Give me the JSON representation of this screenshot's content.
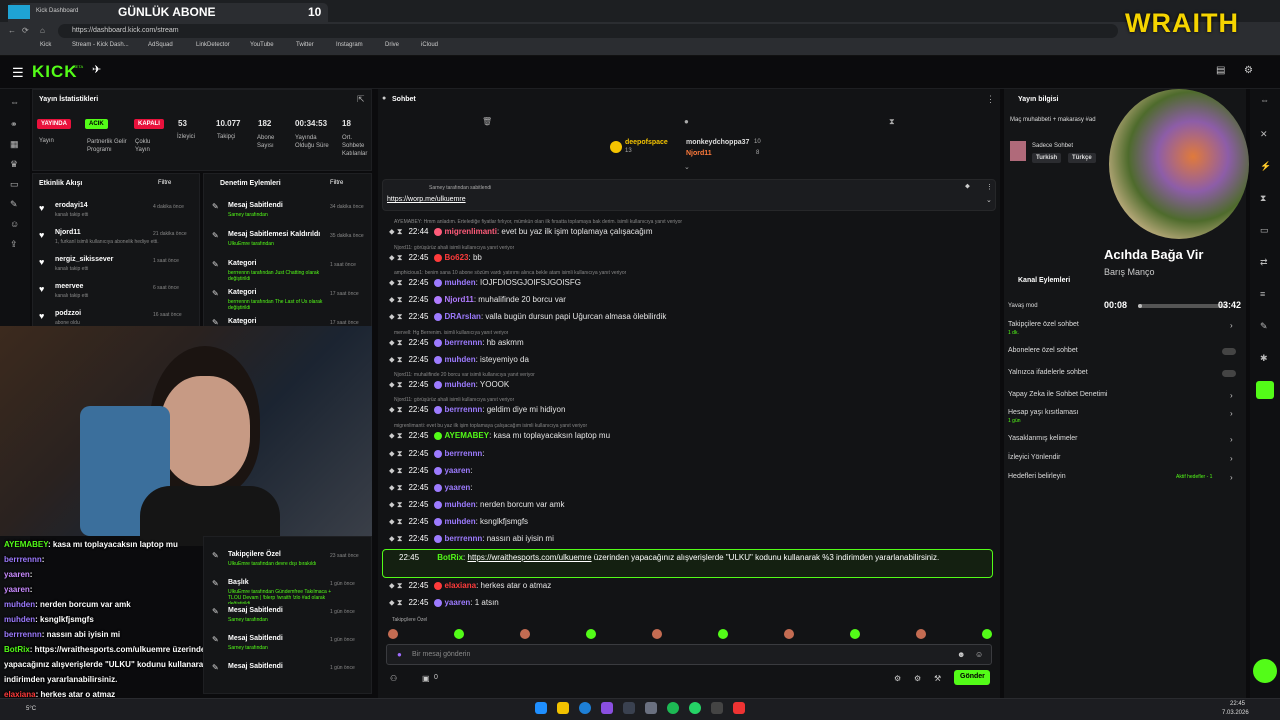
{
  "browser": {
    "tab_title": "Kick Dashboard",
    "overlay_title": "GÜNLÜK ABONE",
    "overlay_count": "10",
    "url": "https://dashboard.kick.com/stream",
    "bookmarks": [
      "Kick",
      "Stream - Kick Dash...",
      "AdSquad",
      "LinkDetector",
      "YouTube",
      "Twitter",
      "Instagram",
      "Drive",
      "iCloud"
    ]
  },
  "brand": {
    "logo": "KICK",
    "beta": "BETA",
    "wraith": "WRAITH",
    "accent": "#53fc18"
  },
  "stats": {
    "title": "Yayın İstatistikleri",
    "items": [
      {
        "badge": "YAYINDA",
        "label": "Yayın",
        "color": "#e9113c"
      },
      {
        "badge": "ACIK",
        "label": "Partnerlik Gelir Programı",
        "color": "#53fc18"
      },
      {
        "badge": "KAPALI",
        "label": "Çoklu Yayın",
        "color": "#e9113c"
      },
      {
        "value": "53",
        "label": "İzleyici"
      },
      {
        "value": "10.077",
        "label": "Takipçi"
      },
      {
        "value": "182",
        "label": "Abone Sayısı"
      },
      {
        "value": "00:34:53",
        "label": "Yayında Olduğu Süre"
      },
      {
        "value": "18",
        "label": "Ort. Sohbete Katılanlar"
      }
    ]
  },
  "activity": {
    "title": "Etkinlik Akışı",
    "filter": "Filtre",
    "items": [
      {
        "name": "erodayi14",
        "desc": "kanalı takip etti",
        "time": "4 dakika önce"
      },
      {
        "name": "Njord11",
        "desc": "1, furkanl isimli kullanıcıya abonelik hediye etti.",
        "time": "21 dakika önce"
      },
      {
        "name": "nergiz_sikissever",
        "desc": "kanalı takip etti",
        "time": "1 saat önce"
      },
      {
        "name": "meervee",
        "desc": "kanalı takip etti",
        "time": "6 saat önce"
      },
      {
        "name": "podzzoi",
        "desc": "abone oldu",
        "time": "16 saat önce"
      }
    ]
  },
  "moderation": {
    "title": "Denetim Eylemleri",
    "filter": "Filtre",
    "items": [
      {
        "action": "Mesaj Sabitlendi",
        "who": "Sarney tarafından",
        "time": "34 dakika önce"
      },
      {
        "action": "Mesaj Sabitlemesi Kaldırıldı",
        "who": "UlkuEmre tarafından",
        "time": "35 dakika önce"
      },
      {
        "action": "Kategori",
        "who": "berrrennn tarafından Just Chatting olarak değiştirildi",
        "time": "1 saat önce"
      },
      {
        "action": "Kategori",
        "who": "berrrennn tarafından The Last of Us olarak değiştirildi",
        "time": "17 saat önce"
      },
      {
        "action": "Kategori",
        "who": "",
        "time": "17 saat önce"
      }
    ],
    "lower": [
      {
        "action": "Takipçilere Özel",
        "who": "UlkuEmre tarafından devre dışı bırakıldı",
        "time": "23 saat önce"
      },
      {
        "action": "Başlık",
        "who": "UlkuEmre tarafından Gündemfree Takılmaca + TLOU Devam | !blerp !wraith !zlo #ad olarak değiştirildi",
        "time": "1 gün önce"
      },
      {
        "action": "Mesaj Sabitlendi",
        "who": "Sarney tarafından",
        "time": "1 gün önce"
      },
      {
        "action": "Mesaj Sabitlendi",
        "who": "Sarney tarafından",
        "time": "1 gün önce"
      },
      {
        "action": "Mesaj Sabitlendi",
        "who": "",
        "time": "1 gün önce"
      }
    ]
  },
  "chat": {
    "title": "Sohbet",
    "top_gifters": [
      {
        "name": "deepofspace",
        "count": "13"
      },
      {
        "name": "monkeydchoppa37",
        "count": "10"
      },
      {
        "name": "Njord11",
        "count": "8"
      }
    ],
    "pinned_by": "Sarney tarafından sabitlendi",
    "pinned_link": "https://worp.me/ulkuemre",
    "messages": [
      {
        "reply": "AYEMABEY: Hmm anladım. Ertelediğe fiyatlar fırlıyor, mümkün olan ilk fırsatta toplamaya bak derim. isimli kullanıcıya yanıt veriyor",
        "time": "22:44",
        "user": "migrenlimanti",
        "color": "#ff5c7a",
        "text": ": evet bu yaz ilk işim toplamaya çalışacağım"
      },
      {
        "time": "22:45",
        "user": "Bo623",
        "color": "#ff3b3b",
        "text": ": bb",
        "reply": "Njord11: görüşürüz ahali isimli kullanıcıya yanıt veriyor"
      },
      {
        "time": "22:45",
        "user": "muhden",
        "color": "#9d7bff",
        "text": ": IOJFDIOSGJOIFSJGOISFG",
        "reply": "amphicious1: benim sana 10 abone sözüm vardı yatırımı alınca bekle atam isimli kullanıcıya yanıt veriyor"
      },
      {
        "time": "22:45",
        "user": "Njord11",
        "color": "#b07bff",
        "text": ": muhalifinde 20 borcu var"
      },
      {
        "time": "22:45",
        "user": "DRArslan",
        "color": "#9d7bff",
        "text": ": valla bugün dursun papi Uğurcan almasa ölebilirdik"
      },
      {
        "time": "22:45",
        "user": "berrrennn",
        "color": "#9d7bff",
        "text": ": hb askmm",
        "reply": "mervell: Hg Berrenim. isimli kullanıcıya yanıt veriyor"
      },
      {
        "time": "22:45",
        "user": "muhden",
        "color": "#9d7bff",
        "text": ": isteyemiyo da"
      },
      {
        "time": "22:45",
        "user": "muhden",
        "color": "#9d7bff",
        "text": ": YOOOK",
        "reply": "Njord11: muhalifinde 20 borcu var isimli kullanıcıya yanıt veriyor"
      },
      {
        "time": "22:45",
        "user": "berrrennn",
        "color": "#9d7bff",
        "text": ": geldim diye mi hidiyon",
        "reply": "Njord11: görüşürüz ahali isimli kullanıcıya yanıt veriyor"
      },
      {
        "time": "22:45",
        "user": "AYEMABEY",
        "color": "#53fc18",
        "text": ": kasa mı toplayacaksın laptop mu",
        "reply": "migrenlimanti: evet bu yaz ilk işim toplamaya çalışacağım isimli kullanıcıya yanıt veriyor"
      },
      {
        "time": "22:45",
        "user": "berrrennn",
        "color": "#9d7bff",
        "text": ":"
      },
      {
        "time": "22:45",
        "user": "yaaren",
        "color": "#9d7bff",
        "text": ":"
      },
      {
        "time": "22:45",
        "user": "yaaren",
        "color": "#9d7bff",
        "text": ":"
      },
      {
        "time": "22:45",
        "user": "muhden",
        "color": "#9d7bff",
        "text": ": nerden borcum var amk"
      },
      {
        "time": "22:45",
        "user": "muhden",
        "color": "#9d7bff",
        "text": ": ksnglkfjsmgfs"
      },
      {
        "time": "22:45",
        "user": "berrrennn",
        "color": "#9d7bff",
        "text": ": nassın abi iyisin mi"
      }
    ],
    "bot": {
      "time": "22:45",
      "user": "BotRix",
      "link": "https://wraithesports.com/ulkuemre",
      "text": " üzerinden yapacağınız alışverişlerde \"ULKU\" kodunu kullanarak %3 indirimden yararlanabilirsiniz."
    },
    "after": [
      {
        "time": "22:45",
        "user": "elaxiana",
        "color": "#ff3b3b",
        "text": ": herkes atar o atmaz"
      },
      {
        "time": "22:45",
        "user": "yaaren",
        "color": "#9d7bff",
        "text": ": 1 atsın"
      }
    ],
    "followers_only": "Takipçilere Özel",
    "placeholder": "Bir mesaj gönderin",
    "count": "0",
    "send": "Gönder"
  },
  "overlay_chat": [
    {
      "user": "AYEMABEY",
      "color": "#53fc18",
      "text": ": kasa mı toplayacaksın laptop mu"
    },
    {
      "user": "berrrennn",
      "color": "#9d7bff",
      "text": ":"
    },
    {
      "user": "yaaren",
      "color": "#c98bff",
      "text": ":"
    },
    {
      "user": "yaaren",
      "color": "#c98bff",
      "text": ":"
    },
    {
      "user": "muhden",
      "color": "#9d7bff",
      "text": ": nerden borcum var amk"
    },
    {
      "user": "muhden",
      "color": "#9d7bff",
      "text": ": ksnglkfjsmgfs"
    },
    {
      "user": "berrrennn",
      "color": "#9d7bff",
      "text": ": nassın abi iyisin mi"
    },
    {
      "user": "BotRix",
      "color": "#53fc18",
      "text": ": https://wraithesports.com/ulkuemre üzerinden"
    },
    {
      "user": "",
      "color": "#fff",
      "text": "yapacağınız alışverişlerde \"ULKU\" kodunu kullanarak %3"
    },
    {
      "user": "",
      "color": "#fff",
      "text": "indirimden yararlanabilirsiniz."
    },
    {
      "user": "elaxiana",
      "color": "#ff3b3b",
      "text": ": herkes atar o atmaz"
    },
    {
      "user": "yaaren",
      "color": "#c98bff",
      "text": ": 1 atsın"
    }
  ],
  "stream_info": {
    "title": "Yayın bilgisi",
    "desc": "Maç muhabbeti + makarasy #ad",
    "category": "Sadece Sohbet",
    "tags": [
      "Turkish",
      "Türkçe"
    ]
  },
  "music": {
    "song": "Acıhda Bağa Vir",
    "artist": "Barış Manço",
    "elapsed": "00:08",
    "total": "03:42",
    "progress": 0.04
  },
  "channel_actions": {
    "title": "Kanal Eylemleri",
    "slow": "Yavaş mod",
    "items": [
      {
        "label": "Takipçilere özel sohbet",
        "sub": "1 dk."
      },
      {
        "label": "Abonelere özel sohbet",
        "sub": ""
      },
      {
        "label": "Yalnızca ifadelerle sohbet",
        "sub": ""
      },
      {
        "label": "Yapay Zeka ile Sohbet Denetimi",
        "sub": ""
      },
      {
        "label": "Hesap yaşı kısıtlaması",
        "sub": "1 gün"
      },
      {
        "label": "Yasaklanmış kelimeler",
        "sub": ""
      },
      {
        "label": "İzleyici Yönlendir",
        "sub": ""
      },
      {
        "label": "Hedefleri belirleyin",
        "sub": "Aktif hedefler - 1"
      }
    ]
  },
  "system": {
    "time": "22:45",
    "date": "7.03.2026",
    "temp": "5°C"
  }
}
